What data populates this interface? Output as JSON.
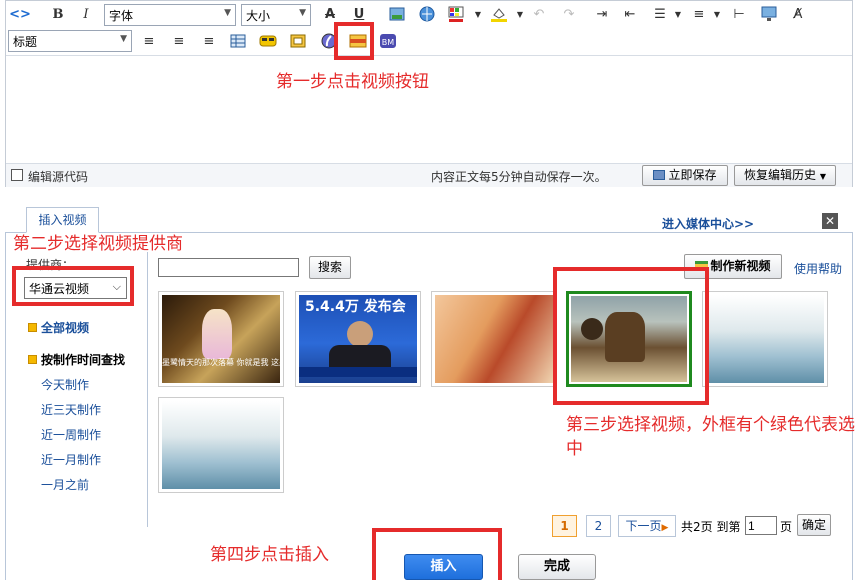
{
  "editor": {
    "toolbar": {
      "font_select": "字体",
      "size_select": "大小",
      "heading_select": "标题"
    },
    "footer": {
      "source_checkbox_label": "编辑源代码",
      "autosave_notice": "内容正文每5分钟自动保存一次。",
      "save_now_label": "立即保存",
      "restore_history_label": "恢复编辑历史"
    }
  },
  "annotations": {
    "step1": "第一步点击视频按钮",
    "step2": "第二步选择视频提供商",
    "step3": "第三步选择视频，外框有个绿色代表选中",
    "step4": "第四步点击插入"
  },
  "dialog": {
    "tab_label": "插入视频",
    "media_center_link": "进入媒体中心>>",
    "provider_label": "提供商：",
    "provider_value": "华通云视频",
    "search_button": "搜索",
    "search_value": "",
    "create_video_button": "制作新视频",
    "help_link": "使用帮助",
    "sidebar": {
      "all_videos": "全部视频",
      "by_time_heading": "按制作时间查找",
      "time_filters": [
        "今天制作",
        "近三天制作",
        "近一周制作",
        "近一月制作",
        "一月之前"
      ]
    },
    "thumbs": [
      {
        "caption": "墨鹭情天的那次落幕 你就是我 这般轻轻"
      },
      {
        "caption": "5.4.4万 发布会"
      },
      {
        "caption": ""
      },
      {
        "caption": "",
        "selected": true
      },
      {
        "caption": ""
      },
      {
        "caption": ""
      }
    ],
    "pager": {
      "current_page": "1",
      "page2": "2",
      "next_label": "下一页",
      "total_label": "共2页 到第",
      "goto_value": "1",
      "page_unit": "页",
      "confirm_label": "确定"
    },
    "insert_button": "插入",
    "done_button": "完成"
  },
  "colors": {
    "annotation_red": "#e52b2b",
    "selected_green": "#1f8a1f",
    "link_blue": "#1a4f9a",
    "insert_blue": "#1e6fdc"
  }
}
